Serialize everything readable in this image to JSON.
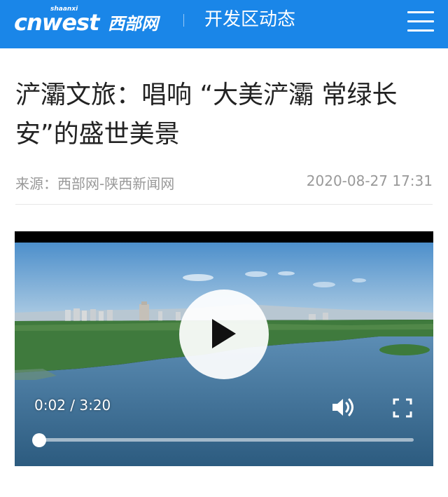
{
  "header": {
    "logo_text": "cnwest",
    "logo_sup": "shaanxi",
    "logo_cn": "西部网",
    "section": "开发区动态",
    "menu_icon": "hamburger-menu-icon",
    "color": "#1a86e8"
  },
  "article": {
    "title": "浐灞文旅：唱响 “大美浐灞 常绿长安”的盛世美景",
    "source": "来源：西部网-陕西新闻网",
    "datetime": "2020-08-27 17:31"
  },
  "video": {
    "time_display": "0:02 / 3:20",
    "progress": 0.01,
    "play_icon": "play-icon",
    "volume_icon": "volume-icon",
    "fullscreen_icon": "fullscreen-icon"
  }
}
